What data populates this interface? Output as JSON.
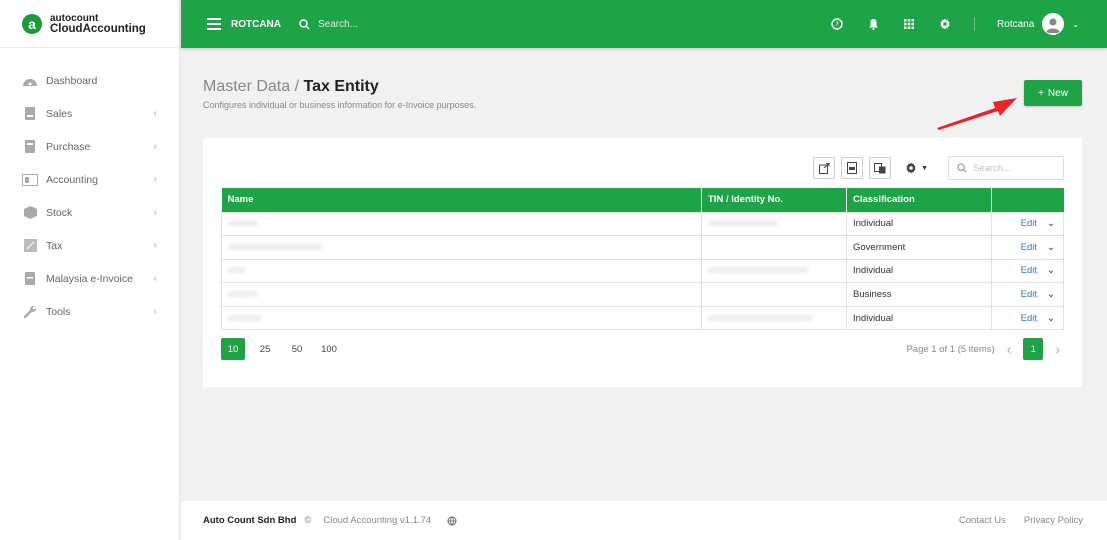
{
  "brand": {
    "top": "autocount",
    "bottom": "CloudAccounting",
    "logo_letter": "a"
  },
  "sidebar": {
    "items": [
      {
        "label": "Dashboard",
        "icon": "dashboard-icon",
        "has_children": false
      },
      {
        "label": "Sales",
        "icon": "sales-icon",
        "has_children": true
      },
      {
        "label": "Purchase",
        "icon": "purchase-icon",
        "has_children": true
      },
      {
        "label": "Accounting",
        "icon": "accounting-icon",
        "has_children": true
      },
      {
        "label": "Stock",
        "icon": "stock-icon",
        "has_children": true
      },
      {
        "label": "Tax",
        "icon": "tax-icon",
        "has_children": true
      },
      {
        "label": "Malaysia e-Invoice",
        "icon": "einvoice-icon",
        "has_children": true
      },
      {
        "label": "Tools",
        "icon": "wrench-icon",
        "has_children": true
      }
    ]
  },
  "header": {
    "company": "ROTCANA",
    "search_placeholder": "Search...",
    "username": "Rotcana"
  },
  "page": {
    "breadcrumb_parent": "Master Data /",
    "title": "Tax Entity",
    "subtitle": "Configures individual or business information for e-Invoice purposes.",
    "new_button": "New"
  },
  "table": {
    "search_placeholder": "Search...",
    "columns": [
      "Name",
      "TIN / Identity No.",
      "Classification",
      ""
    ],
    "rows": [
      {
        "classification": "Individual",
        "action": "Edit"
      },
      {
        "classification": "Government",
        "action": "Edit"
      },
      {
        "classification": "Individual",
        "action": "Edit"
      },
      {
        "classification": "Business",
        "action": "Edit"
      },
      {
        "classification": "Individual",
        "action": "Edit"
      }
    ]
  },
  "pagination": {
    "page_sizes": [
      "10",
      "25",
      "50",
      "100"
    ],
    "active_size": "10",
    "info": "Page 1 of 1 (5 items)",
    "current_page": "1"
  },
  "footer": {
    "company": "Auto Count Sdn Bhd",
    "copyright": "©",
    "product": "Cloud Accounting v1.1.74",
    "links": [
      "Contact Us",
      "Privacy Policy"
    ]
  },
  "colors": {
    "brand_green": "#1fa347",
    "link_blue": "#2a7ad4",
    "arrow_red": "#e8232a"
  }
}
